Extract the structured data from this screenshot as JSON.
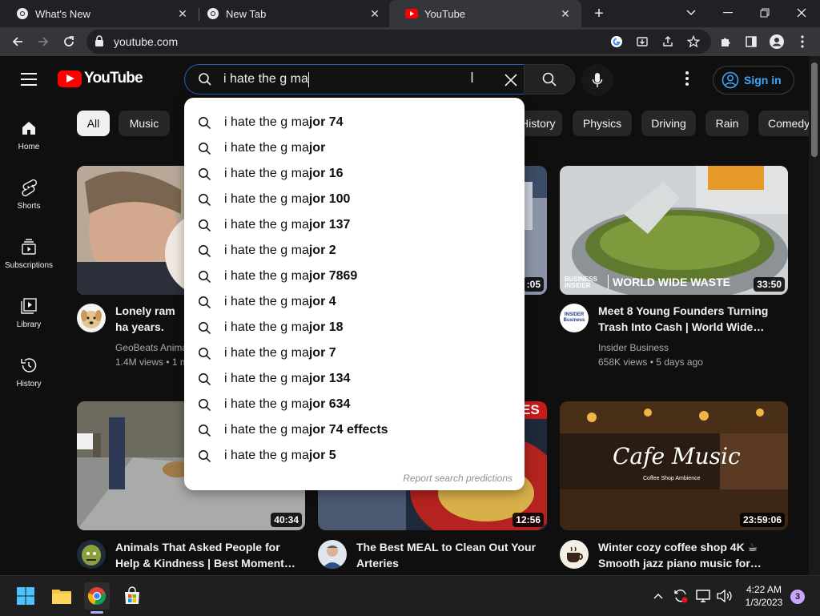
{
  "browser": {
    "tabs": [
      {
        "label": "What's New"
      },
      {
        "label": "New Tab"
      },
      {
        "label": "YouTube"
      }
    ],
    "url": "youtube.com"
  },
  "youtube": {
    "logo_text": "YouTube",
    "search": {
      "query": "i hate the g ma"
    },
    "sign_in_label": "Sign in",
    "guide": [
      {
        "label": "Home"
      },
      {
        "label": "Shorts"
      },
      {
        "label": "Subscriptions"
      },
      {
        "label": "Library"
      },
      {
        "label": "History"
      }
    ],
    "chips": [
      "All",
      "Music",
      "History",
      "Physics",
      "Driving",
      "Rain",
      "Comedy"
    ],
    "suggestions": [
      {
        "prefix": "i hate the g ma",
        "suffix": "jor 74"
      },
      {
        "prefix": "i hate the g ma",
        "suffix": "jor"
      },
      {
        "prefix": "i hate the g ma",
        "suffix": "jor 16"
      },
      {
        "prefix": "i hate the g ma",
        "suffix": "jor 100"
      },
      {
        "prefix": "i hate the g ma",
        "suffix": "jor 137"
      },
      {
        "prefix": "i hate the g ma",
        "suffix": "jor 2"
      },
      {
        "prefix": "i hate the g ma",
        "suffix": "jor 7869"
      },
      {
        "prefix": "i hate the g ma",
        "suffix": "jor 4"
      },
      {
        "prefix": "i hate the g ma",
        "suffix": "jor 18"
      },
      {
        "prefix": "i hate the g ma",
        "suffix": "jor 7"
      },
      {
        "prefix": "i hate the g ma",
        "suffix": "jor 134"
      },
      {
        "prefix": "i hate the g ma",
        "suffix": "jor 634"
      },
      {
        "prefix": "i hate the g ma",
        "suffix": "jor 74 effects"
      },
      {
        "prefix": "i hate the g ma",
        "suffix": "jor 5"
      }
    ],
    "report_label": "Report search predictions",
    "videos": [
      {
        "title": "Lonely ram ha years. This w",
        "channel": "GeoBeats Anima",
        "meta": "1.4M views • 1 m",
        "duration": ""
      },
      {
        "title": "",
        "channel": "",
        "meta": "",
        "duration": ":05"
      },
      {
        "title": "Meet 8 Young Founders Turning Trash Into Cash | World Wide…",
        "channel": "Insider Business",
        "meta": "658K views • 5 days ago",
        "duration": "33:50",
        "thumb_caption_top": "BUSINESS INSIDER",
        "thumb_caption": "WORLD WIDE WASTE"
      },
      {
        "title": "Animals That Asked People for Help & Kindness | Best Moment…",
        "channel": "",
        "meta": "",
        "duration": "40:34"
      },
      {
        "title": "The Best MEAL to Clean Out Your Arteries",
        "channel": "",
        "meta": "",
        "duration": "12:56",
        "thumb_caption": "ES"
      },
      {
        "title": "Winter cozy coffee shop 4K ☕ Smooth jazz piano music for…",
        "channel": "",
        "meta": "",
        "duration": "23:59:06",
        "thumb_caption": "Cafe Music",
        "thumb_caption_sub": "Coffee Shop Ambience"
      }
    ],
    "avatar_texts": {
      "insider": "INSIDER Business"
    }
  },
  "taskbar": {
    "time": "4:22 AM",
    "date": "1/3/2023",
    "notifications": "3"
  },
  "colors": {
    "yt_red": "#ff0000",
    "link_blue": "#3ea6ff",
    "search_focus": "#1c62b9",
    "bg": "#0f0f0f"
  }
}
